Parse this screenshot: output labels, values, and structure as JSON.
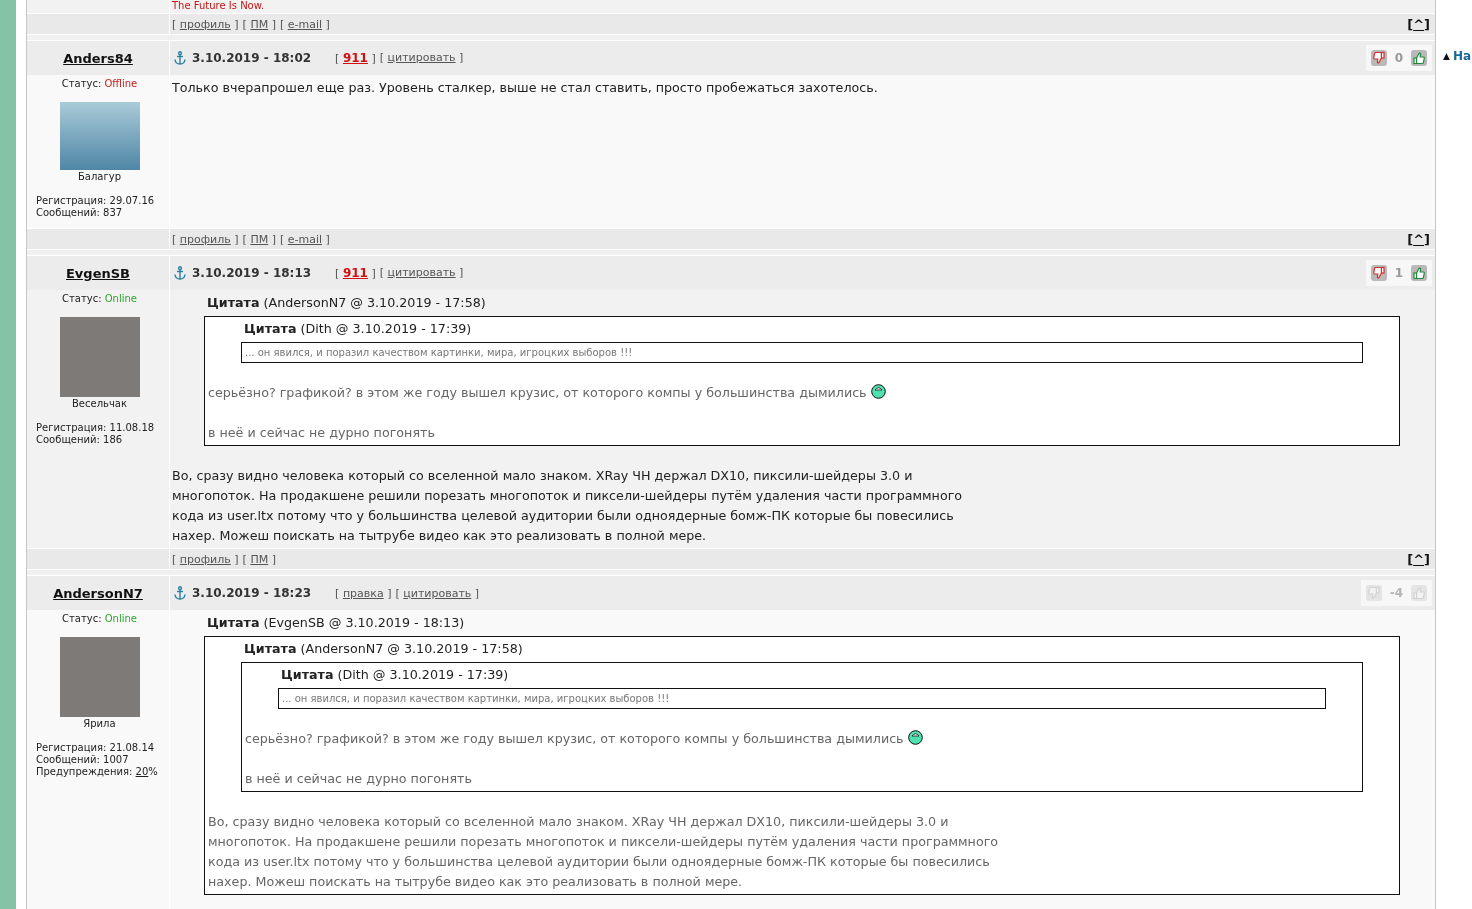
{
  "nav": {
    "arrow": "▲",
    "label": "На"
  },
  "previous_post": {
    "signature": "The Future Is Now.",
    "footer_links": [
      {
        "open": "[",
        "label": "профиль",
        "close": "]"
      },
      {
        "open": "[",
        "label": "ПМ",
        "close": "]"
      },
      {
        "open": "[",
        "label": "e-mail",
        "close": "]"
      }
    ],
    "top_button": {
      "open": "[",
      "label": "^",
      "close": "]"
    }
  },
  "posts": [
    {
      "author": "Anders84",
      "date": "3.10.2019 - 18:02",
      "actions": [
        {
          "kind": "alert",
          "open": "[",
          "label": "911",
          "close": "]"
        },
        {
          "kind": "link",
          "open": "[",
          "label": "цитировать",
          "close": "]"
        }
      ],
      "rating": {
        "count": "0",
        "disabled": false
      },
      "status": {
        "label": "Статус:",
        "value": "Offline",
        "online": false
      },
      "avatar": {
        "kind": "illustration"
      },
      "rank": "Балагур",
      "stats": [
        {
          "kind": "text",
          "label": "Регистрация:",
          "value": "29.07.16"
        },
        {
          "kind": "text",
          "label": "Сообщений:",
          "value": "837"
        }
      ],
      "body": [
        {
          "kind": "text",
          "text": "Только вчерапрошел еще раз. Уровень сталкер, выше не стал ставить, просто пробежаться захотелось.",
          "emoticon": false
        }
      ],
      "footer_links": [
        {
          "open": "[",
          "label": "профиль",
          "close": "]"
        },
        {
          "open": "[",
          "label": "ПМ",
          "close": "]"
        },
        {
          "open": "[",
          "label": "e-mail",
          "close": "]"
        }
      ],
      "top_button": {
        "open": "[",
        "label": "^",
        "close": "]"
      }
    },
    {
      "author": "EvgenSB",
      "date": "3.10.2019 - 18:13",
      "actions": [
        {
          "kind": "alert",
          "open": "[",
          "label": "911",
          "close": "]"
        },
        {
          "kind": "link",
          "open": "[",
          "label": "цитировать",
          "close": "]"
        }
      ],
      "rating": {
        "count": "1",
        "disabled": false
      },
      "status": {
        "label": "Статус:",
        "value": "Online",
        "online": true
      },
      "avatar": {
        "kind": "photo"
      },
      "rank": "Весельчак",
      "stats": [
        {
          "kind": "text",
          "label": "Регистрация:",
          "value": "11.08.18"
        },
        {
          "kind": "text",
          "label": "Сообщений:",
          "value": "186"
        }
      ],
      "body": [
        {
          "kind": "quote",
          "title": "Цитата",
          "source": "(AndersonN7 @ 3.10.2019 - 17:58)",
          "body": [
            {
              "kind": "quote",
              "title": "Цитата",
              "source": "(Dith @ 3.10.2019 - 17:39)",
              "body": [
                {
                  "kind": "small_text",
                  "text": "... он явился, и поразил качеством картинки, мира, игроцких выборов !!!"
                }
              ]
            },
            {
              "kind": "text",
              "text": "серьёзно? графикой? в этом же году вышел крузис, от которого компы у большинства дымились",
              "emoticon": true
            },
            {
              "kind": "text",
              "text": "в неё и сейчас не дурно погонять",
              "emoticon": false
            }
          ]
        },
        {
          "kind": "text",
          "text": "Во, сразу видно человека который со вселенной мало знаком. XRay ЧН держал DX10, пиксили-шейдеры 3.0 и\nмногопоток. На продакшене решили порезать многопоток и пиксели-шейдеры путём удаления части программного\nкода из user.ltx потому что у большинства целевой аудитории были одноядерные бомж-ПК которые бы повесились\nнахер. Можеш поискать на тытрубе видео как это реализовать в полной мере.",
          "emoticon": false
        }
      ],
      "footer_links": [
        {
          "open": "[",
          "label": "профиль",
          "close": "]"
        },
        {
          "open": "[",
          "label": "ПМ",
          "close": "]"
        }
      ],
      "top_button": {
        "open": "[",
        "label": "^",
        "close": "]"
      }
    },
    {
      "author": "AndersonN7",
      "date": "3.10.2019 - 18:23",
      "actions": [
        {
          "kind": "link",
          "open": "[",
          "label": "правка",
          "close": "]"
        },
        {
          "kind": "link",
          "open": "[",
          "label": "цитировать",
          "close": "]"
        }
      ],
      "rating": {
        "count": "-4",
        "disabled": true
      },
      "status": {
        "label": "Статус:",
        "value": "Online",
        "online": true
      },
      "avatar": {
        "kind": "photo"
      },
      "rank": "Ярила",
      "stats": [
        {
          "kind": "text",
          "label": "Регистрация:",
          "value": "21.08.14"
        },
        {
          "kind": "text",
          "label": "Сообщений:",
          "value": "1007"
        },
        {
          "kind": "link",
          "label": "Предупреждения:",
          "value": "20",
          "suffix": "%"
        }
      ],
      "body": [
        {
          "kind": "quote",
          "title": "Цитата",
          "source": "(EvgenSB @ 3.10.2019 - 18:13)",
          "body": [
            {
              "kind": "quote",
              "title": "Цитата",
              "source": "(AndersonN7 @ 3.10.2019 - 17:58)",
              "body": [
                {
                  "kind": "quote",
                  "title": "Цитата",
                  "source": "(Dith @ 3.10.2019 - 17:39)",
                  "body": [
                    {
                      "kind": "small_text",
                      "text": "... он явился, и поразил качеством картинки, мира, игроцких выборов !!!"
                    }
                  ]
                },
                {
                  "kind": "text",
                  "text": "серьёзно? графикой? в этом же году вышел крузис, от которого компы у большинства дымились",
                  "emoticon": true
                },
                {
                  "kind": "text",
                  "text": "в неё и сейчас не дурно погонять",
                  "emoticon": false
                }
              ]
            },
            {
              "kind": "text",
              "text": "Во, сразу видно человека который со вселенной мало знаком. XRay ЧН держал DX10, пиксили-шейдеры 3.0 и\nмногопоток. На продакшене решили порезать многопоток и пиксели-шейдеры путём удаления части программного\nкода из user.ltx потому что у большинства целевой аудитории были одноядерные бомж-ПК которые бы повесились\nнахер. Можеш поискать на тытрубе видео как это реализовать в полной мере.",
              "emoticon": false
            }
          ]
        }
      ]
    }
  ]
}
